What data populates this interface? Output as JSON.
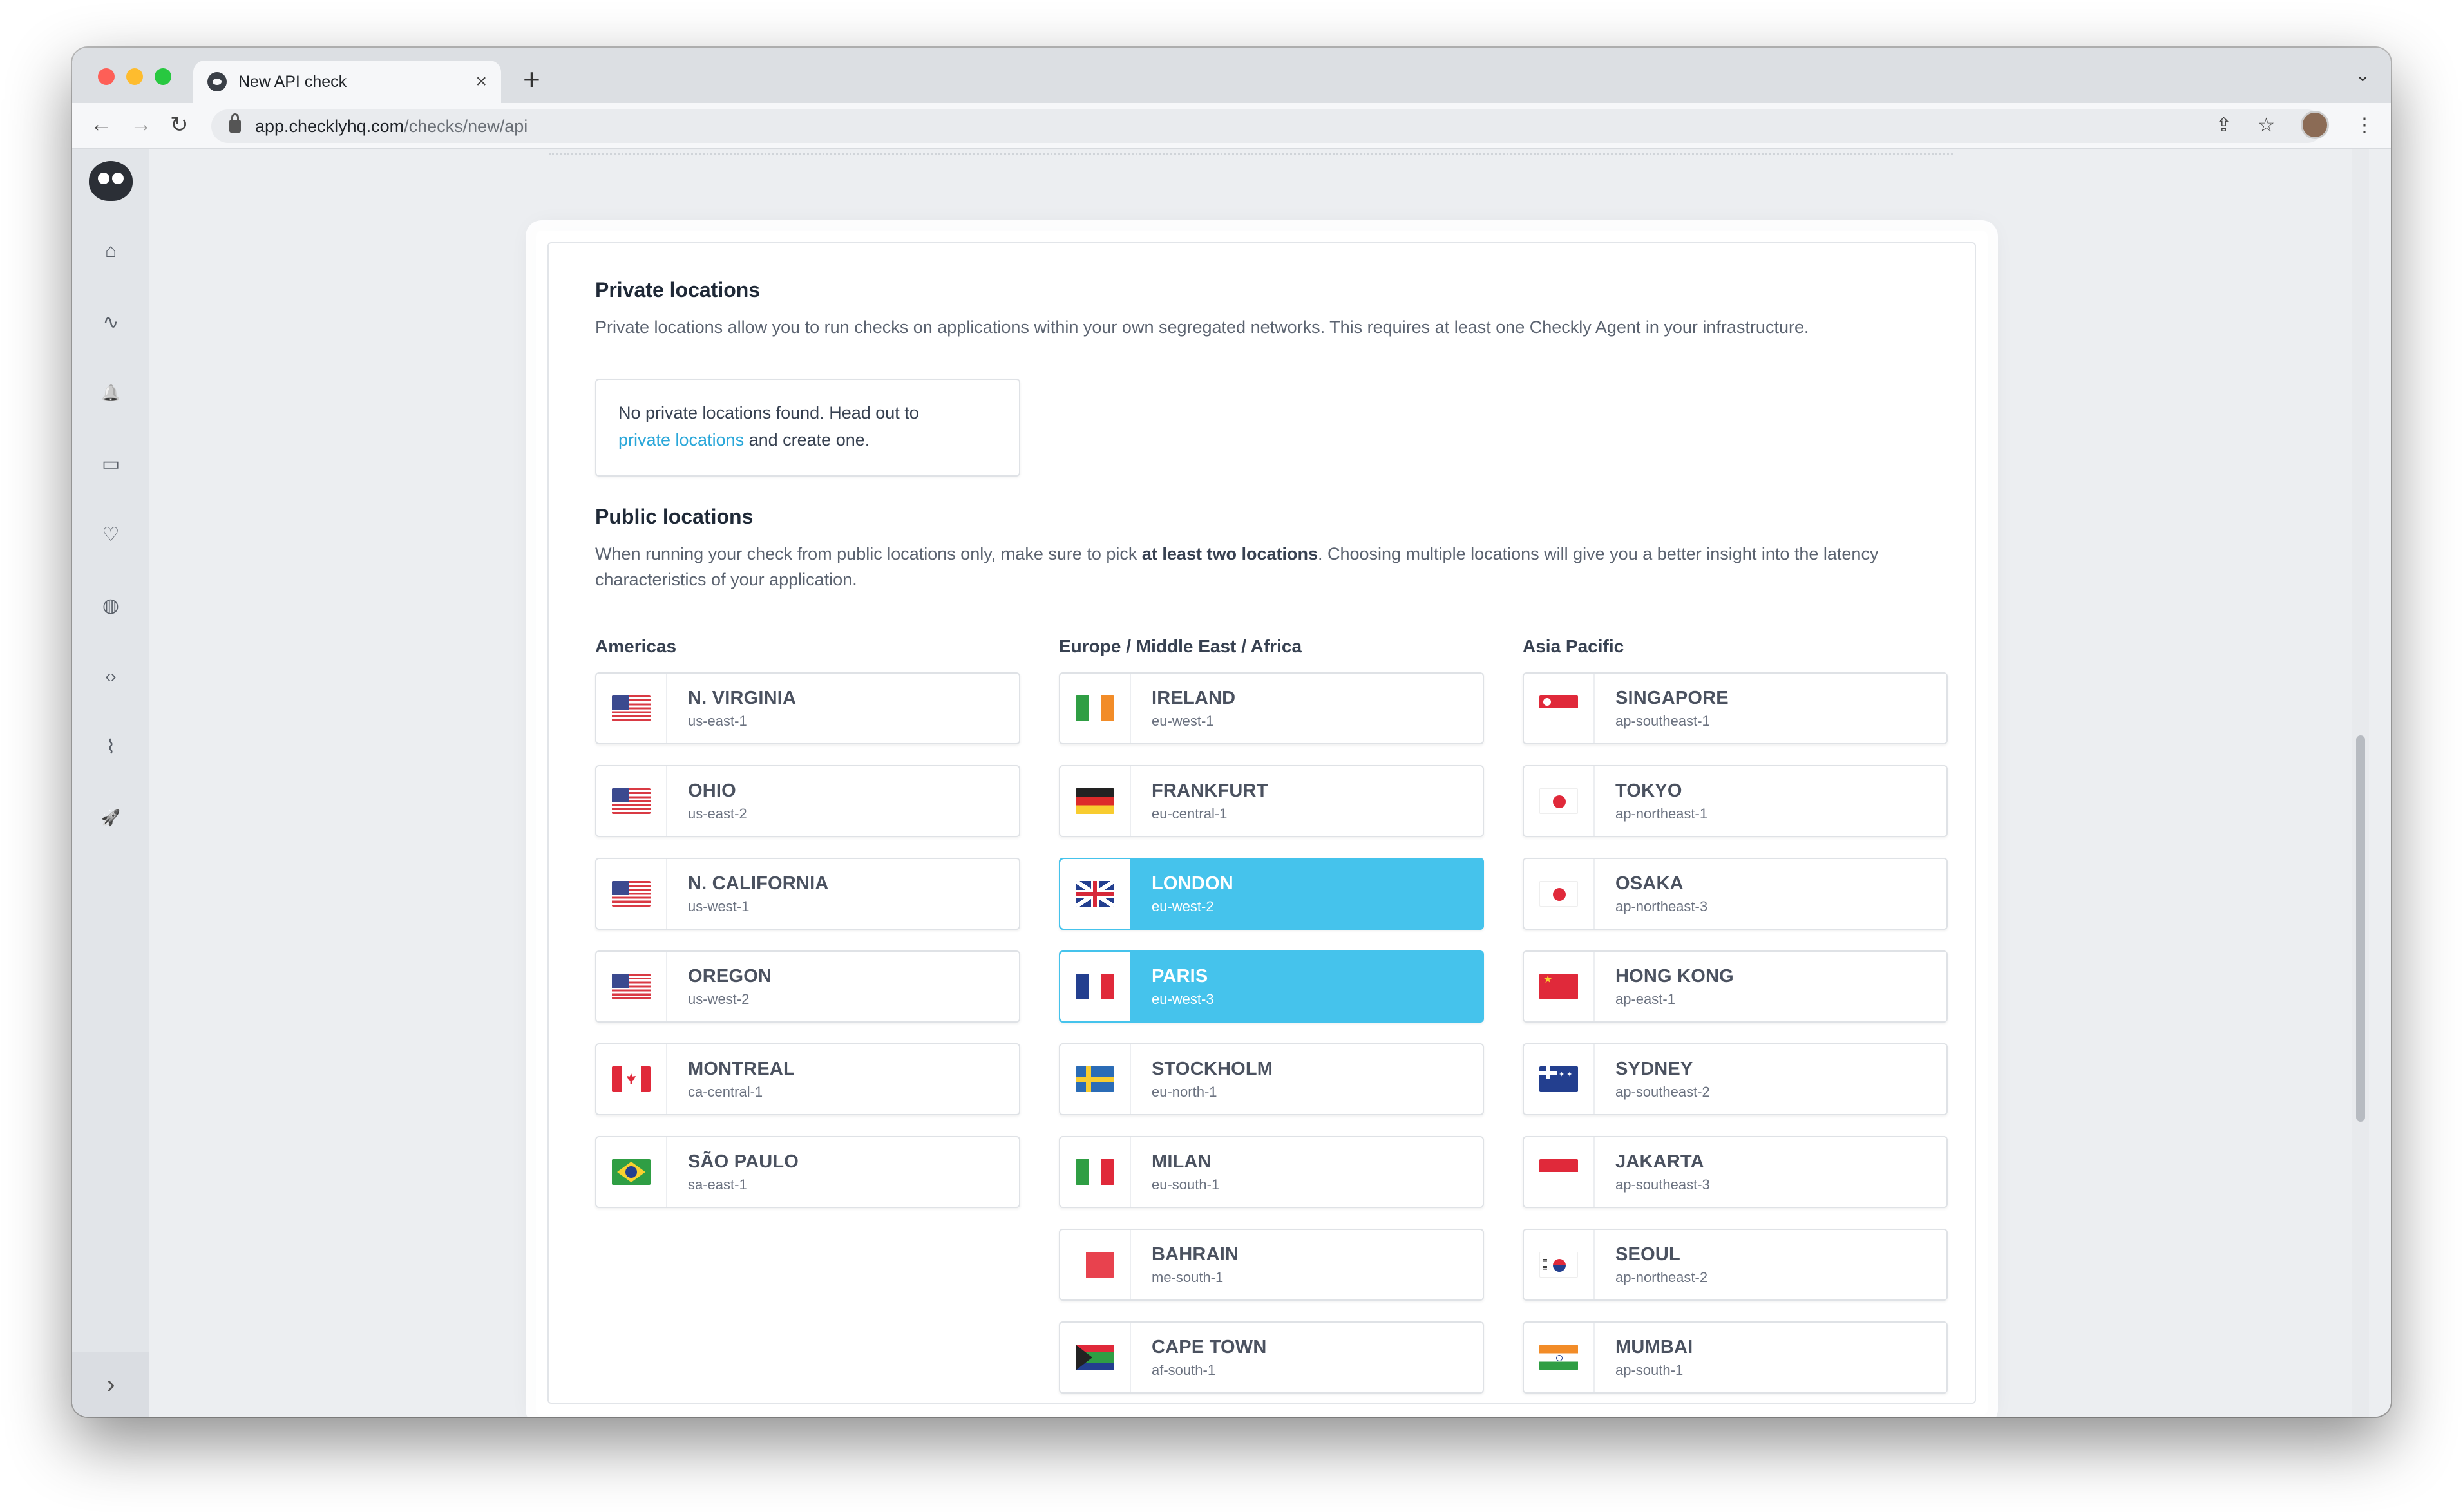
{
  "browser": {
    "tab_title": "New API check",
    "tab_close": "×",
    "new_tab": "+",
    "tabs_menu": "⌄",
    "url_host": "app.checklyhq.com",
    "url_path": "/checks/new/api",
    "back_icon": "←",
    "forward_icon": "→",
    "reload_icon": "↻",
    "share_icon": "⇪",
    "star_icon": "☆",
    "menu_icon": "⋮"
  },
  "sidebar": {
    "icons": [
      "home-icon",
      "activity-icon",
      "bell-icon",
      "monitor-icon",
      "heartbeat-icon",
      "globe-icon",
      "code-icon",
      "chart-icon",
      "rocket-icon"
    ],
    "glyphs": [
      "⌂",
      "∿",
      "🔔",
      "▭",
      "♡",
      "◍",
      "‹›",
      "⌇",
      "🚀"
    ],
    "expand_glyph": "›"
  },
  "private": {
    "title": "Private locations",
    "description": "Private locations allow you to run checks on applications within your own segregated networks. This requires at least one Checkly Agent in your infrastructure.",
    "empty_text_1": "No private locations found. Head out to",
    "empty_link": "private locations",
    "empty_text_2": " and create one."
  },
  "public": {
    "title": "Public locations",
    "description_1": "When running your check from public locations only, make sure to pick ",
    "description_bold": "at least two locations",
    "description_2": ". Choosing multiple locations will give you a better insight into the latency characteristics of your application.",
    "columns": [
      {
        "title": "Americas",
        "locations": [
          {
            "name": "N. VIRGINIA",
            "code": "us-east-1",
            "flag": "us",
            "selected": false
          },
          {
            "name": "OHIO",
            "code": "us-east-2",
            "flag": "us",
            "selected": false
          },
          {
            "name": "N. CALIFORNIA",
            "code": "us-west-1",
            "flag": "us",
            "selected": false
          },
          {
            "name": "OREGON",
            "code": "us-west-2",
            "flag": "us",
            "selected": false
          },
          {
            "name": "MONTREAL",
            "code": "ca-central-1",
            "flag": "ca",
            "selected": false
          },
          {
            "name": "SÃO PAULO",
            "code": "sa-east-1",
            "flag": "br",
            "selected": false
          }
        ]
      },
      {
        "title": "Europe / Middle East / Africa",
        "locations": [
          {
            "name": "IRELAND",
            "code": "eu-west-1",
            "flag": "ie",
            "selected": false
          },
          {
            "name": "FRANKFURT",
            "code": "eu-central-1",
            "flag": "de",
            "selected": false
          },
          {
            "name": "LONDON",
            "code": "eu-west-2",
            "flag": "gb",
            "selected": true
          },
          {
            "name": "PARIS",
            "code": "eu-west-3",
            "flag": "fr",
            "selected": true
          },
          {
            "name": "STOCKHOLM",
            "code": "eu-north-1",
            "flag": "se",
            "selected": false
          },
          {
            "name": "MILAN",
            "code": "eu-south-1",
            "flag": "it",
            "selected": false
          },
          {
            "name": "BAHRAIN",
            "code": "me-south-1",
            "flag": "bh",
            "selected": false
          },
          {
            "name": "CAPE TOWN",
            "code": "af-south-1",
            "flag": "za",
            "selected": false
          }
        ]
      },
      {
        "title": "Asia Pacific",
        "locations": [
          {
            "name": "SINGAPORE",
            "code": "ap-southeast-1",
            "flag": "sg",
            "selected": false
          },
          {
            "name": "TOKYO",
            "code": "ap-northeast-1",
            "flag": "jp",
            "selected": false
          },
          {
            "name": "OSAKA",
            "code": "ap-northeast-3",
            "flag": "jp",
            "selected": false
          },
          {
            "name": "HONG KONG",
            "code": "ap-east-1",
            "flag": "cn",
            "selected": false
          },
          {
            "name": "SYDNEY",
            "code": "ap-southeast-2",
            "flag": "au",
            "selected": false
          },
          {
            "name": "JAKARTA",
            "code": "ap-southeast-3",
            "flag": "id",
            "selected": false
          },
          {
            "name": "SEOUL",
            "code": "ap-northeast-2",
            "flag": "kr",
            "selected": false
          },
          {
            "name": "MUMBAI",
            "code": "ap-south-1",
            "flag": "in",
            "selected": false
          }
        ]
      }
    ]
  },
  "colors": {
    "selected": "#45c3ec",
    "link": "#2aa7d9"
  }
}
